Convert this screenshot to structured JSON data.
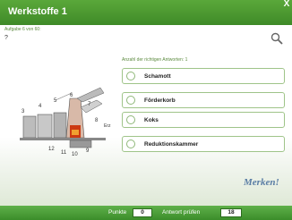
{
  "window": {
    "title": "Werkstoffe 1",
    "close_glyph": "X"
  },
  "task": {
    "label": "Aufgabe 6 von 60:",
    "question": "?"
  },
  "icons": {
    "search": "magnifier-icon"
  },
  "answers_header": "Anzahl der richtigen Antworten: 1",
  "answers": [
    {
      "label": "Schamott"
    },
    {
      "label": "Förderkorb"
    },
    {
      "label": "Koks"
    },
    {
      "label": "Reduktionskammer"
    }
  ],
  "diagram": {
    "labels": [
      "3",
      "4",
      "5",
      "6",
      "7",
      "8",
      "Erz",
      "12",
      "11",
      "10",
      "9"
    ]
  },
  "merken_label": "Merken!",
  "footer": {
    "points_label": "Punkte",
    "points_value": "0",
    "check_label": "Antwort prüfen",
    "timer_value": "18"
  },
  "colors": {
    "accent": "#4a9a30",
    "border": "#9fc489",
    "merken": "#5a7da5"
  }
}
